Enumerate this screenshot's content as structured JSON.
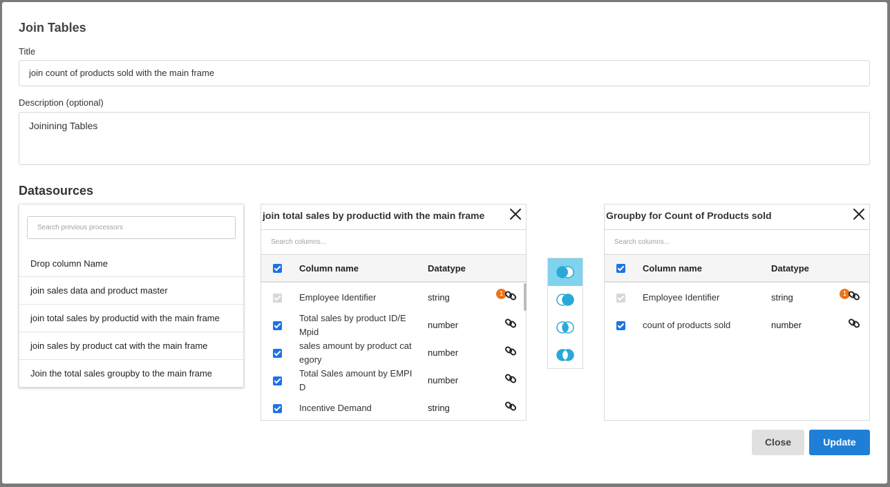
{
  "dialog": {
    "title": "Join Tables"
  },
  "form": {
    "title_label": "Title",
    "title_value": "join count of products sold with the main frame",
    "description_label": "Description (optional)",
    "description_value": "Joinining Tables"
  },
  "datasources": {
    "heading": "Datasources",
    "search_placeholder": "Search previous processors",
    "processors": [
      "Drop column Name",
      "join sales data and product master",
      "join total sales by productid with the main frame",
      "join sales by product cat with the main frame",
      "Join the total sales groupby to the main frame"
    ]
  },
  "left_panel": {
    "title": "join total sales by productid with the main frame",
    "search_placeholder": "Search columns...",
    "col_name_header": "Column name",
    "datatype_header": "Datatype",
    "rows": [
      {
        "name": "Employee Identifier",
        "type": "string",
        "checked": "disabled",
        "badge": "1"
      },
      {
        "name": "Total sales by product ID/E Mpid",
        "type": "number",
        "checked": "true"
      },
      {
        "name": "sales amount by product cat egory",
        "type": "number",
        "checked": "true"
      },
      {
        "name": "Total Sales amount by EMPI D",
        "type": "number",
        "checked": "true"
      },
      {
        "name": "Incentive Demand",
        "type": "string",
        "checked": "true"
      }
    ]
  },
  "right_panel": {
    "title": "Groupby for Count of Products sold",
    "search_placeholder": "Search columns...",
    "col_name_header": "Column name",
    "datatype_header": "Datatype",
    "rows": [
      {
        "name": "Employee Identifier",
        "type": "string",
        "checked": "disabled",
        "badge": "1"
      },
      {
        "name": "count of products sold",
        "type": "number",
        "checked": "true"
      }
    ]
  },
  "join_types": [
    "left-join-icon",
    "right-join-icon",
    "inner-join-icon",
    "outer-join-icon"
  ],
  "colors": {
    "accent": "#1f7fd6",
    "join_active": "#7fd3ec",
    "badge": "#e8741c",
    "join_icon": "#29a9d8"
  },
  "actions": {
    "close_label": "Close",
    "update_label": "Update"
  }
}
